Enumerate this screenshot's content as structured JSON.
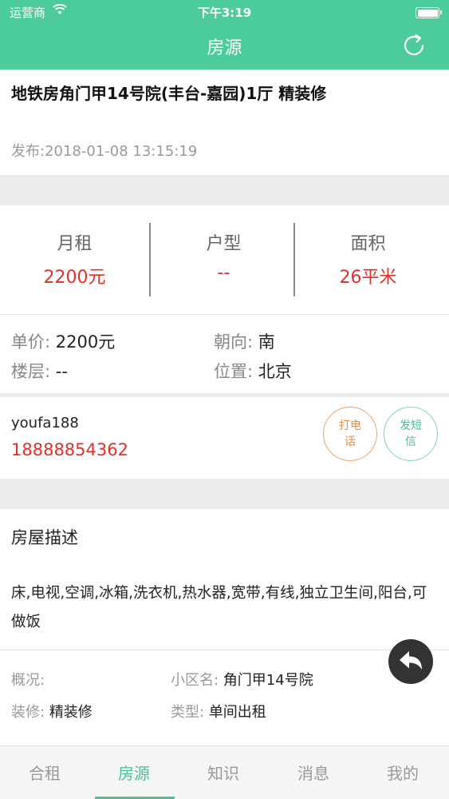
{
  "status_bar": {
    "carrier": "运营商",
    "time": "下午3:19",
    "battery_level": 1.0
  },
  "header": {
    "title": "房源",
    "refresh_icon": "refresh-icon"
  },
  "listing": {
    "title": "地铁房角门甲14号院(丰台-嘉园)1厅 精装修",
    "published": "发布:2018-01-08 13:15:19"
  },
  "stats": [
    {
      "label": "月租",
      "value": "2200元"
    },
    {
      "label": "户型",
      "value": "--"
    },
    {
      "label": "面积",
      "value": "26平米"
    }
  ],
  "attributes": {
    "unit_price": {
      "key": "单价:",
      "value": "2200元"
    },
    "orientation": {
      "key": "朝向:",
      "value": "南"
    },
    "floor": {
      "key": "楼层:",
      "value": "--"
    },
    "location": {
      "key": "位置:",
      "value": "北京"
    }
  },
  "contact": {
    "name": "youfa188",
    "phone": "18888854362",
    "call_label": "打电话",
    "sms_label": "发短信"
  },
  "description": {
    "heading": "房屋描述",
    "text": "床,电视,空调,冰箱,洗衣机,热水器,宽带,有线,独立卫生间,阳台,可做饭"
  },
  "details": {
    "overview": {
      "key": "概况:",
      "value": ""
    },
    "community": {
      "key": "小区名:",
      "value": "角门甲14号院"
    },
    "decoration": {
      "key": "装修:",
      "value": "精装修"
    },
    "type": {
      "key": "类型:",
      "value": "单间出租"
    }
  },
  "tabs": [
    {
      "label": "合租",
      "active": false
    },
    {
      "label": "房源",
      "active": true
    },
    {
      "label": "知识",
      "active": false
    },
    {
      "label": "消息",
      "active": false
    },
    {
      "label": "我的",
      "active": false
    }
  ],
  "colors": {
    "brand": "#4ccb9b",
    "price": "#e0302b",
    "call": "#ef8a3f",
    "sms": "#4cbf93"
  }
}
